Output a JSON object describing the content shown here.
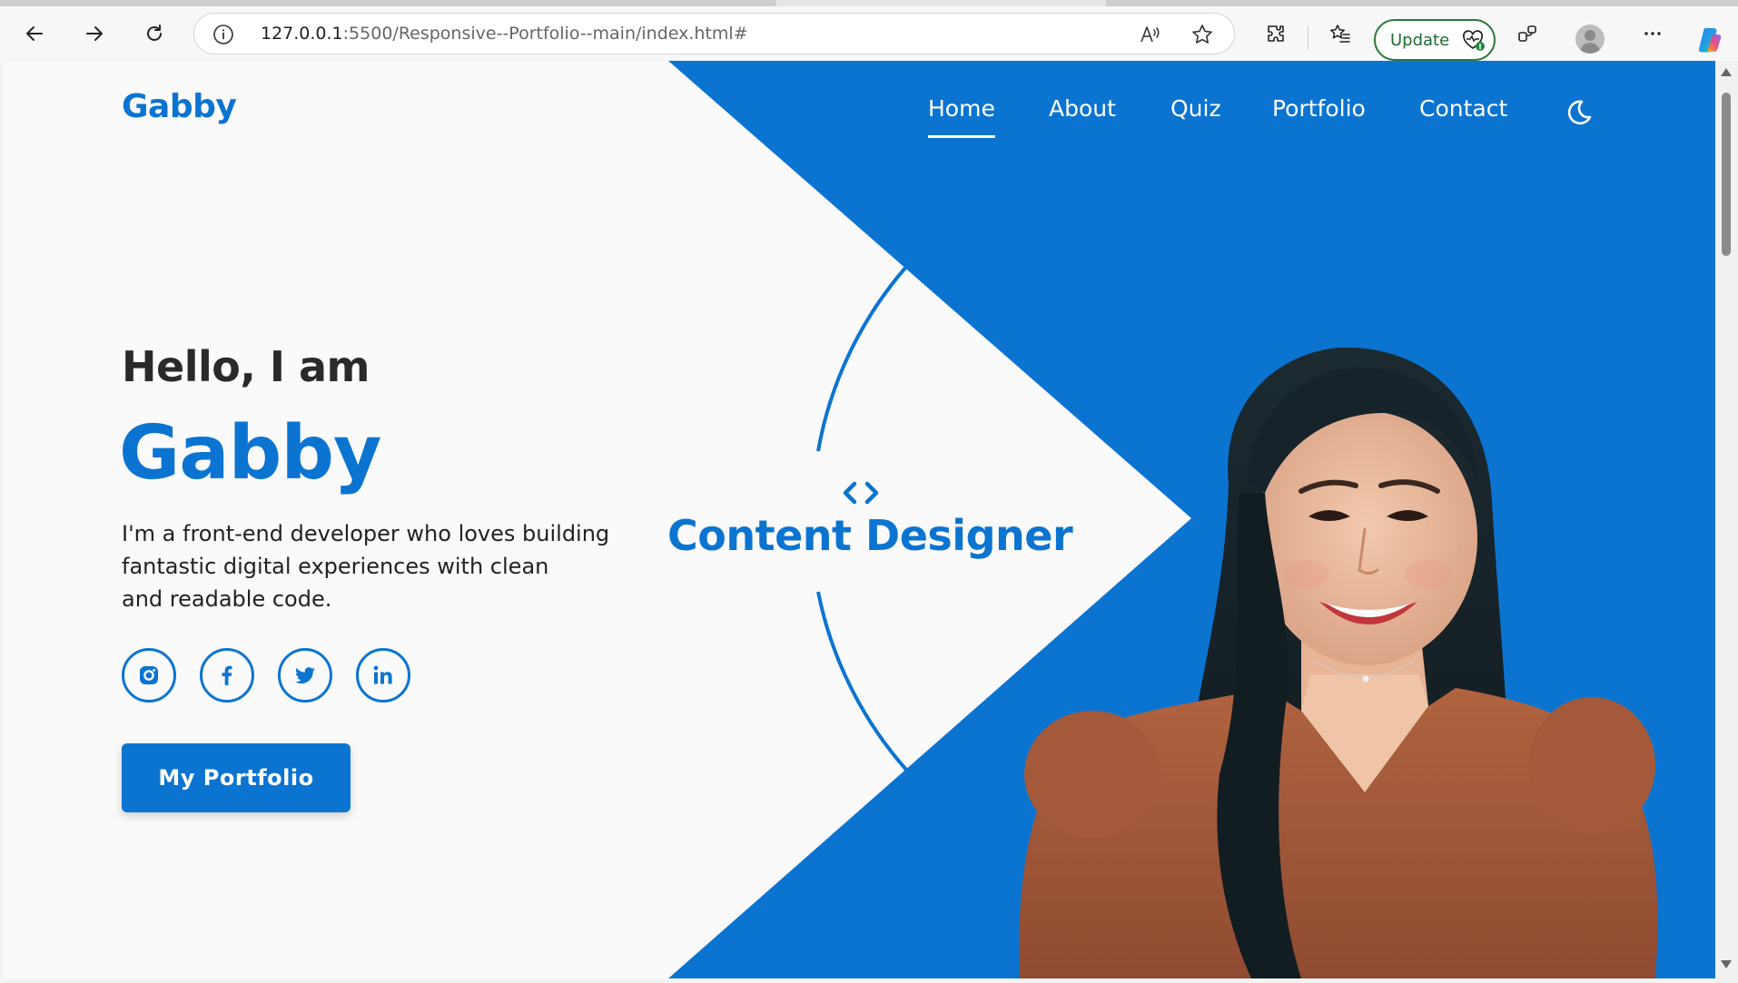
{
  "browser": {
    "url_host": "127.0.0.1",
    "url_rest": ":5500/Responsive--Portfolio--main/index.html#",
    "update_label": "Update",
    "icons": [
      "back-icon",
      "forward-icon",
      "refresh-icon",
      "info-icon",
      "read-aloud-icon",
      "favorite-star-icon",
      "extensions-icon",
      "favorites-icon",
      "update-heart-icon",
      "browser-essentials-icon",
      "profile-avatar-icon",
      "more-icon",
      "copilot-icon"
    ]
  },
  "site": {
    "logo": "Gabby",
    "nav": {
      "home": "Home",
      "about": "About",
      "quiz": "Quiz",
      "portfolio": "Portfolio",
      "contact": "Contact"
    },
    "hero": {
      "greeting": "Hello, I am",
      "name": "Gabby",
      "intro_line1": "I'm a front-end developer who loves building",
      "intro_line2": "fantastic digital experiences with clean",
      "intro_line3": "and readable code.",
      "role": "Content Designer",
      "cta": "My Portfolio"
    },
    "socials": [
      "instagram-icon",
      "facebook-icon",
      "twitter-icon",
      "linkedin-icon"
    ]
  },
  "colors": {
    "brand_blue": "#0b74d1",
    "page_bg": "#fafafa",
    "heading_dark": "#2a2a2a",
    "shirt_brown": "#a65a3c",
    "update_green": "#2c7a3c"
  }
}
